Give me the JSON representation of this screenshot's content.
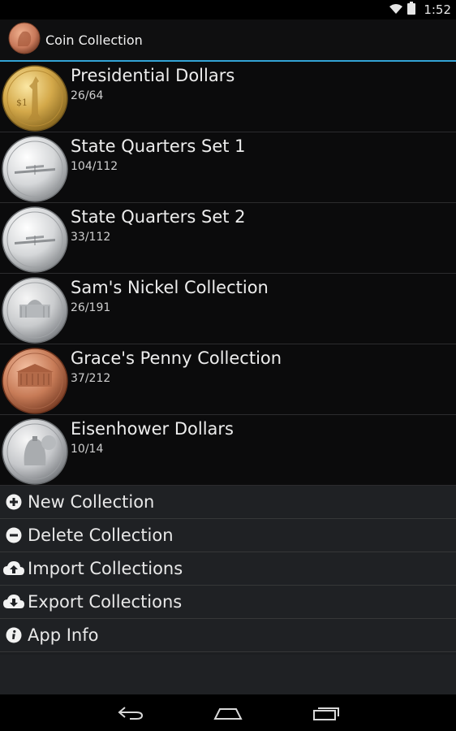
{
  "status": {
    "time": "1:52"
  },
  "app": {
    "title": "Coin Collection",
    "logo_icon": "penny-logo-icon"
  },
  "collections": [
    {
      "name": "Presidential Dollars",
      "count": "26/64",
      "coin": "presidential-dollar-coin-icon"
    },
    {
      "name": "State Quarters Set 1",
      "count": "104/112",
      "coin": "state-quarter-coin-icon"
    },
    {
      "name": "State Quarters Set 2",
      "count": "33/112",
      "coin": "state-quarter-coin-icon"
    },
    {
      "name": "Sam's Nickel Collection",
      "count": "26/191",
      "coin": "nickel-coin-icon"
    },
    {
      "name": "Grace's Penny Collection",
      "count": "37/212",
      "coin": "penny-coin-icon"
    },
    {
      "name": "Eisenhower Dollars",
      "count": "10/14",
      "coin": "eisenhower-dollar-coin-icon"
    }
  ],
  "menu": [
    {
      "label": "New Collection",
      "icon": "plus-circle-icon"
    },
    {
      "label": "Delete Collection",
      "icon": "minus-circle-icon"
    },
    {
      "label": "Import Collections",
      "icon": "cloud-upload-icon"
    },
    {
      "label": "Export Collections",
      "icon": "cloud-download-icon"
    },
    {
      "label": "App Info",
      "icon": "info-icon"
    }
  ],
  "colors": {
    "accent": "#33a3d6",
    "gold": "#c9a24a",
    "silver": "#cfd2d4",
    "copper": "#c47a55"
  }
}
